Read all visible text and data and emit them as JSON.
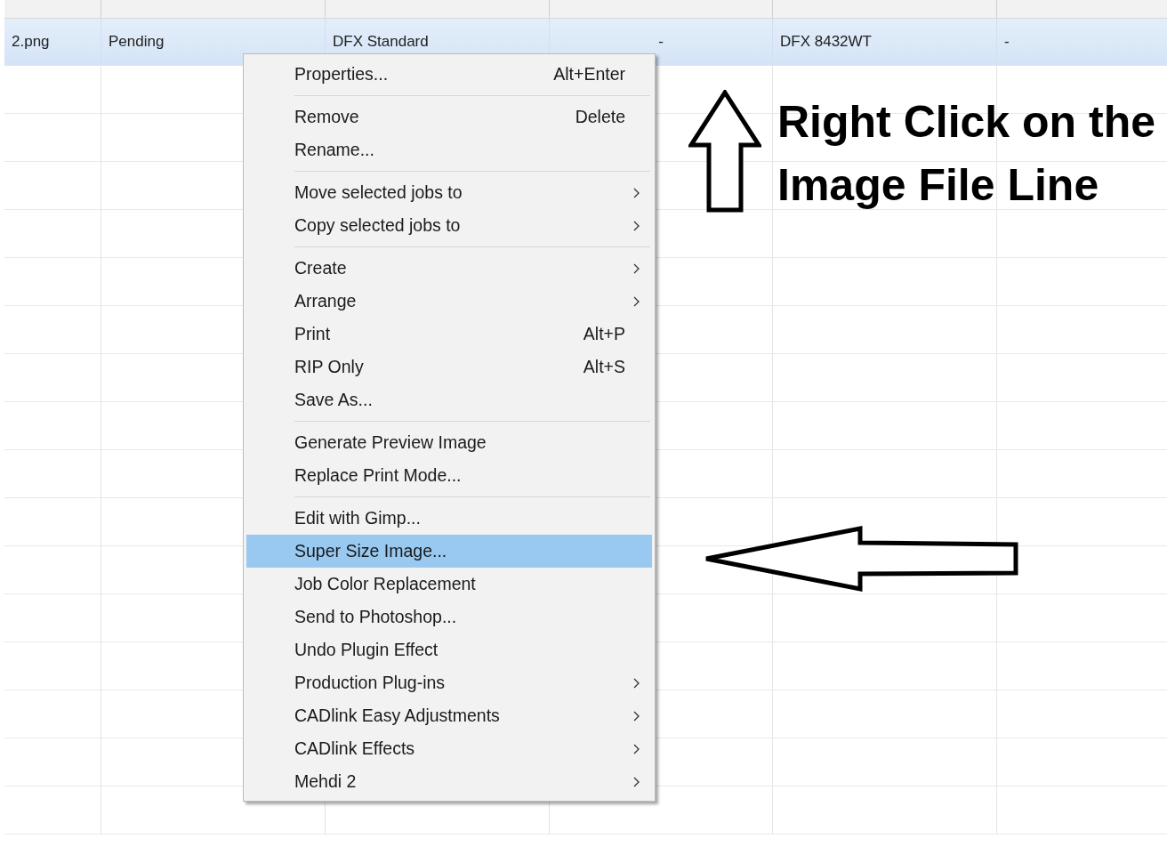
{
  "table": {
    "rows": [
      {
        "selected": true,
        "cells": [
          "2.png",
          "Pending",
          "DFX Standard",
          "-",
          "DFX 8432WT",
          "-"
        ]
      }
    ]
  },
  "context_menu": {
    "items": [
      {
        "kind": "item",
        "label": "Properties...",
        "shortcut": "Alt+Enter",
        "submenu": false,
        "selected": false
      },
      {
        "kind": "separator"
      },
      {
        "kind": "item",
        "label": "Remove",
        "shortcut": "Delete",
        "submenu": false,
        "selected": false
      },
      {
        "kind": "item",
        "label": "Rename...",
        "submenu": false,
        "selected": false
      },
      {
        "kind": "separator"
      },
      {
        "kind": "item",
        "label": "Move selected jobs to",
        "submenu": true,
        "selected": false
      },
      {
        "kind": "item",
        "label": "Copy selected jobs to",
        "submenu": true,
        "selected": false
      },
      {
        "kind": "separator"
      },
      {
        "kind": "item",
        "label": "Create",
        "submenu": true,
        "selected": false
      },
      {
        "kind": "item",
        "label": "Arrange",
        "submenu": true,
        "selected": false
      },
      {
        "kind": "item",
        "label": "Print",
        "shortcut": "Alt+P",
        "submenu": false,
        "selected": false
      },
      {
        "kind": "item",
        "label": "RIP Only",
        "shortcut": "Alt+S",
        "submenu": false,
        "selected": false
      },
      {
        "kind": "item",
        "label": "Save As...",
        "submenu": false,
        "selected": false
      },
      {
        "kind": "separator"
      },
      {
        "kind": "item",
        "label": "Generate Preview Image",
        "submenu": false,
        "selected": false
      },
      {
        "kind": "item",
        "label": "Replace Print Mode...",
        "submenu": false,
        "selected": false
      },
      {
        "kind": "separator"
      },
      {
        "kind": "item",
        "label": "Edit with Gimp...",
        "submenu": false,
        "selected": false
      },
      {
        "kind": "item",
        "label": "Super Size Image...",
        "submenu": false,
        "selected": true
      },
      {
        "kind": "item",
        "label": "Job Color Replacement",
        "submenu": false,
        "selected": false
      },
      {
        "kind": "item",
        "label": "Send to Photoshop...",
        "submenu": false,
        "selected": false
      },
      {
        "kind": "item",
        "label": "Undo Plugin Effect",
        "submenu": false,
        "selected": false
      },
      {
        "kind": "item",
        "label": "Production Plug-ins",
        "submenu": true,
        "selected": false
      },
      {
        "kind": "item",
        "label": "CADlink Easy Adjustments",
        "submenu": true,
        "selected": false
      },
      {
        "kind": "item",
        "label": "CADlink Effects",
        "submenu": true,
        "selected": false
      },
      {
        "kind": "item",
        "label": "Mehdi 2",
        "submenu": true,
        "selected": false
      }
    ]
  },
  "annotation": {
    "lines": [
      "Right Click on the",
      "Image File Line"
    ]
  }
}
